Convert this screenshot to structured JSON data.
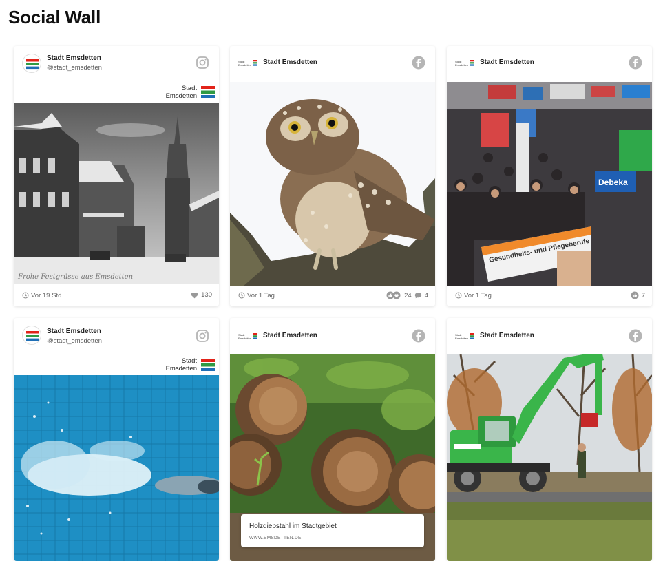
{
  "page": {
    "title": "Social Wall"
  },
  "posts": [
    {
      "author": "Stadt Emsdetten",
      "handle": "@stadt_emsdetten",
      "network": "instagram-icon",
      "brand": {
        "line1": "Stadt",
        "line2": "Emsdetten"
      },
      "time": "Vor 19 Std.",
      "likes": "130"
    },
    {
      "author": "Stadt Emsdetten",
      "network": "facebook-icon",
      "time": "Vor 1 Tag",
      "reactions": "24",
      "comments": "4"
    },
    {
      "author": "Stadt Emsdetten",
      "network": "facebook-icon",
      "time": "Vor 1 Tag",
      "reactions": "7"
    },
    {
      "author": "Stadt Emsdetten",
      "handle": "@stadt_emsdetten",
      "network": "instagram-icon",
      "brand": {
        "line1": "Stadt",
        "line2": "Emsdetten"
      }
    },
    {
      "author": "Stadt Emsdetten",
      "network": "facebook-icon",
      "link": {
        "title": "Holzdiebstahl im Stadtgebiet",
        "domain": "WWW.EMSDETTEN.DE"
      }
    },
    {
      "author": "Stadt Emsdetten",
      "network": "facebook-icon"
    }
  ],
  "colors": {
    "logo_red": "#e2231a",
    "logo_green": "#2f9a44",
    "logo_blue": "#1f6fb6",
    "icon_gray": "#b5b5b5",
    "accent_green": "#3ab54a"
  }
}
